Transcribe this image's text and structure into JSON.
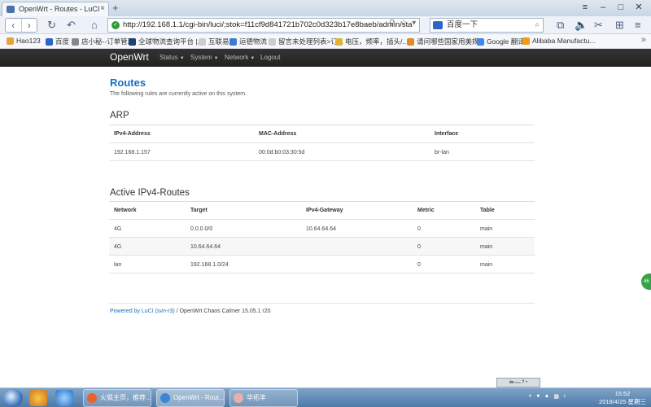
{
  "browser": {
    "tab_title": "OpenWrt - Routes - LuCI",
    "url": "http://192.168.1.1/cgi-bin/luci/;stok=f11cf9d841721b702c0d323b17e8baeb/admin/sta",
    "search_text": "百度一下",
    "bookmarks": [
      "Hao123",
      "百度",
      "店小秘--订单管理",
      "全球物流查询平台 |...",
      "互联易",
      "运德物流",
      "留言未处理列表>订...",
      "电压，频率，插头/...",
      "请问哪些国家用美规...",
      "Google 翻译",
      "Alibaba Manufactu..."
    ]
  },
  "openwrt_nav": {
    "brand": "OpenWrt",
    "menu": [
      "Status",
      "System",
      "Network",
      "Logout"
    ]
  },
  "page": {
    "title": "Routes",
    "description": "The following rules are currently active on this system."
  },
  "arp": {
    "title": "ARP",
    "headers": [
      "IPv4-Address",
      "MAC-Address",
      "Interface"
    ],
    "rows": [
      [
        "192.168.1.157",
        "00:0d:b0:03:30:5d",
        "br-lan"
      ]
    ]
  },
  "routes": {
    "title": "Active IPv4-Routes",
    "headers": [
      "Network",
      "Target",
      "IPv4-Gateway",
      "Metric",
      "Table"
    ],
    "rows": [
      [
        "4G",
        "0.0.0.0/0",
        "10.64.64.64",
        "0",
        "main"
      ],
      [
        "4G",
        "10.64.64.64",
        "",
        "0",
        "main"
      ],
      [
        "lan",
        "192.168.1.0/24",
        "",
        "0",
        "main"
      ]
    ]
  },
  "footer": {
    "link": "Powered by LuCI (svn-r3)",
    "text": " / OpenWrt Chaos Calmer 15.05.1 r20"
  },
  "side_tab": "46",
  "taskbar": {
    "tasks": [
      "火狐主页，推荐...",
      "OpenWrt - Rout...",
      "华拓丰"
    ],
    "time": "15:52",
    "date": "2018/4/25 星期三"
  },
  "colors": {
    "link": "#1b6ec2",
    "nav": "#222222",
    "taskbar": "#4e7aa7"
  }
}
